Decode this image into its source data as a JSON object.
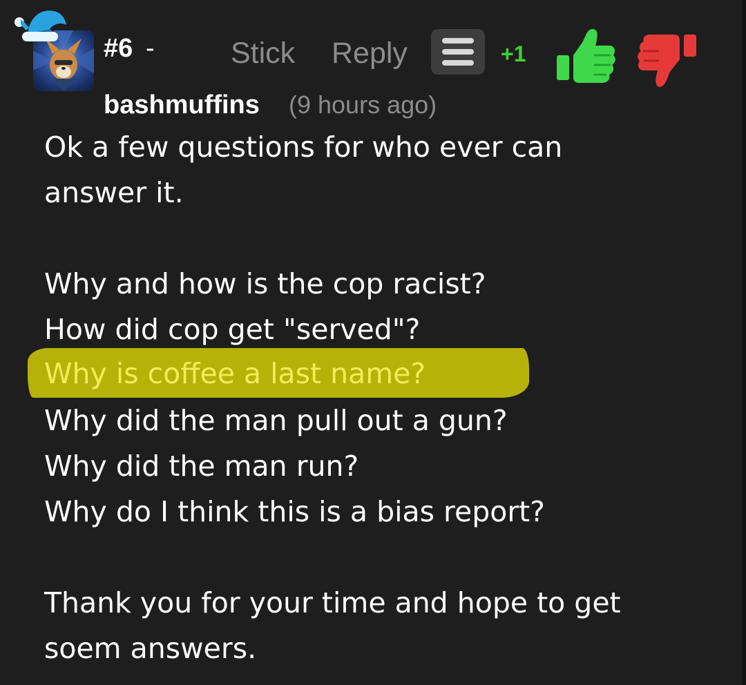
{
  "post": {
    "number": "#6",
    "separator": "-",
    "actions": {
      "stick": "Stick",
      "reply": "Reply"
    },
    "score": "+1",
    "author": "bashmuffins",
    "timestamp": "(9 hours ago)"
  },
  "body": {
    "intro_line_1": "Ok a few questions for who ever can",
    "intro_line_2": "answer it.",
    "questions": [
      "Why and how is the cop racist?",
      "How did cop get \"served\"?",
      "Why is coffee a last name?",
      "Why did the man pull out a gun?",
      "Why did the man run?",
      "Why do I think this is a bias report?"
    ],
    "closing_line_1": "Thank you for your time and hope to get",
    "closing_line_2": "soem answers."
  },
  "icons": {
    "hat": "santa-hat-icon",
    "menu": "hamburger-menu-icon",
    "upvote": "thumbs-up-icon",
    "downvote": "thumbs-down-icon"
  },
  "colors": {
    "background": "#1e1e1e",
    "score_green": "#3ed12f",
    "thumb_up_green": "#3fd84a",
    "thumb_down_red": "#e63a3a",
    "highlight": "#b7b20a",
    "highlight_text": "#f2ec55",
    "muted_text": "#8c8c8c"
  }
}
